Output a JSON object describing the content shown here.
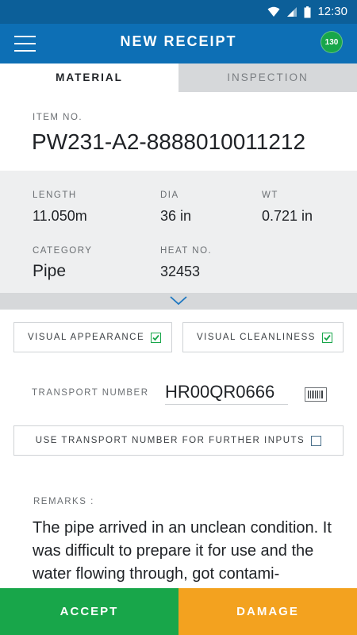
{
  "status_bar": {
    "time": "12:30"
  },
  "app_bar": {
    "title": "NEW RECEIPT",
    "badge": "130"
  },
  "tabs": [
    {
      "label": "MATERIAL",
      "active": true
    },
    {
      "label": "INSPECTION",
      "active": false
    }
  ],
  "item": {
    "label": "ITEM NO.",
    "value": "PW231-A2-8888010011212"
  },
  "details": {
    "length": {
      "label": "LENGTH",
      "value": "11.050m"
    },
    "dia": {
      "label": "DIA",
      "value": "36 in"
    },
    "wt": {
      "label": "WT",
      "value": "0.721 in"
    },
    "category": {
      "label": "CATEGORY",
      "value": "Pipe"
    },
    "heat_no": {
      "label": "HEAT NO.",
      "value": "32453"
    }
  },
  "checks": {
    "visual_appearance": {
      "label": "VISUAL APPEARANCE",
      "checked": true
    },
    "visual_cleanliness": {
      "label": "VISUAL CLEANLINESS",
      "checked": true
    }
  },
  "transport": {
    "label": "TRANSPORT NUMBER",
    "value": "HR00QR0666"
  },
  "use_transport": {
    "label": "USE TRANSPORT NUMBER FOR FURTHER INPUTS",
    "checked": false
  },
  "remarks": {
    "label": "REMARKS :",
    "text": "The pipe arrived in an unclean condition. It  was difficult to prepare it for use and the water flowing through, got contami-"
  },
  "actions": {
    "accept": "ACCEPT",
    "damage": "DAMAGE"
  },
  "colors": {
    "primary": "#0d6fb5",
    "status_bar": "#0c5f99",
    "accept": "#18a64a",
    "damage": "#f3a21f",
    "check": "#18a64a"
  },
  "icons": {
    "menu": "hamburger-icon",
    "wifi": "wifi-icon",
    "signal": "signal-icon",
    "battery": "battery-icon",
    "expand": "chevron-down-icon",
    "barcode": "barcode-icon",
    "check": "checkmark-icon"
  }
}
